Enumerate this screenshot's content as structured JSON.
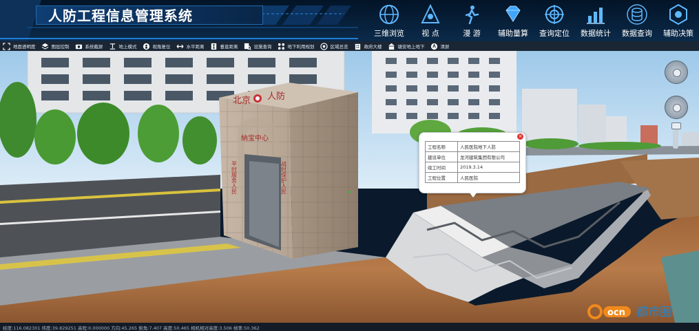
{
  "app": {
    "title": "人防工程信息管理系统"
  },
  "nav": {
    "items": [
      {
        "label": "三维浏览",
        "icon": "globe-icon"
      },
      {
        "label": "视 点",
        "icon": "eye-icon"
      },
      {
        "label": "漫 游",
        "icon": "walk-icon"
      },
      {
        "label": "辅助量算",
        "icon": "diamond-icon"
      },
      {
        "label": "查询定位",
        "icon": "target-icon"
      },
      {
        "label": "数据统计",
        "icon": "bar-chart-icon"
      },
      {
        "label": "数据查询",
        "icon": "database-icon"
      },
      {
        "label": "辅助决策",
        "icon": "shield-icon"
      }
    ]
  },
  "toolbar": {
    "items": [
      {
        "label": "地面透明度",
        "icon": "expand-icon"
      },
      {
        "label": "图层控制",
        "icon": "layers-icon"
      },
      {
        "label": "系统截屏",
        "icon": "camera-icon"
      },
      {
        "label": "地上模式",
        "icon": "ground-icon"
      },
      {
        "label": "视角复位",
        "icon": "person-icon"
      },
      {
        "label": "水平距离",
        "icon": "horizontal-arrow-icon"
      },
      {
        "label": "垂直距离",
        "icon": "vertical-arrow-icon"
      },
      {
        "label": "设施查询",
        "icon": "search-doc-icon"
      },
      {
        "label": "地下利用规划",
        "icon": "plan-icon"
      },
      {
        "label": "区域总览",
        "icon": "region-icon"
      },
      {
        "label": "政府大楼",
        "icon": "building-icon"
      },
      {
        "label": "塘安地上地下",
        "icon": "underground-icon"
      },
      {
        "label": "清屏",
        "icon": "clear-icon"
      }
    ]
  },
  "popup": {
    "rows": [
      {
        "key": "工程名称",
        "value": "人民医院地下人防"
      },
      {
        "key": "建设单位",
        "value": "龙河建筑集团有限公司"
      },
      {
        "key": "竣工时间",
        "value": "2019.3.14"
      },
      {
        "key": "工程位置",
        "value": "人民医院"
      }
    ]
  },
  "scene": {
    "sign_top": "北京",
    "sign_top_right": "人防",
    "arch_text": "納宝中心",
    "left_couplet": "平时服务人民",
    "right_couplet": "战时保护人民"
  },
  "status": {
    "text": "经度:116.082301  纬度:39.829251  高程:0.000000  方向:45.265  俯角:7.407  高度:50.465  相机相对高度:3.506  帧率:50.362"
  },
  "logo": {
    "text": "都市圈",
    "mark": "ocn"
  },
  "colors": {
    "header_bg": "#0b2a4a",
    "accent_blue": "#1e7fd8",
    "toolbar_bg": "#1b2634",
    "logo_orange": "#f08a1c",
    "logo_blue": "#1a87d6"
  }
}
